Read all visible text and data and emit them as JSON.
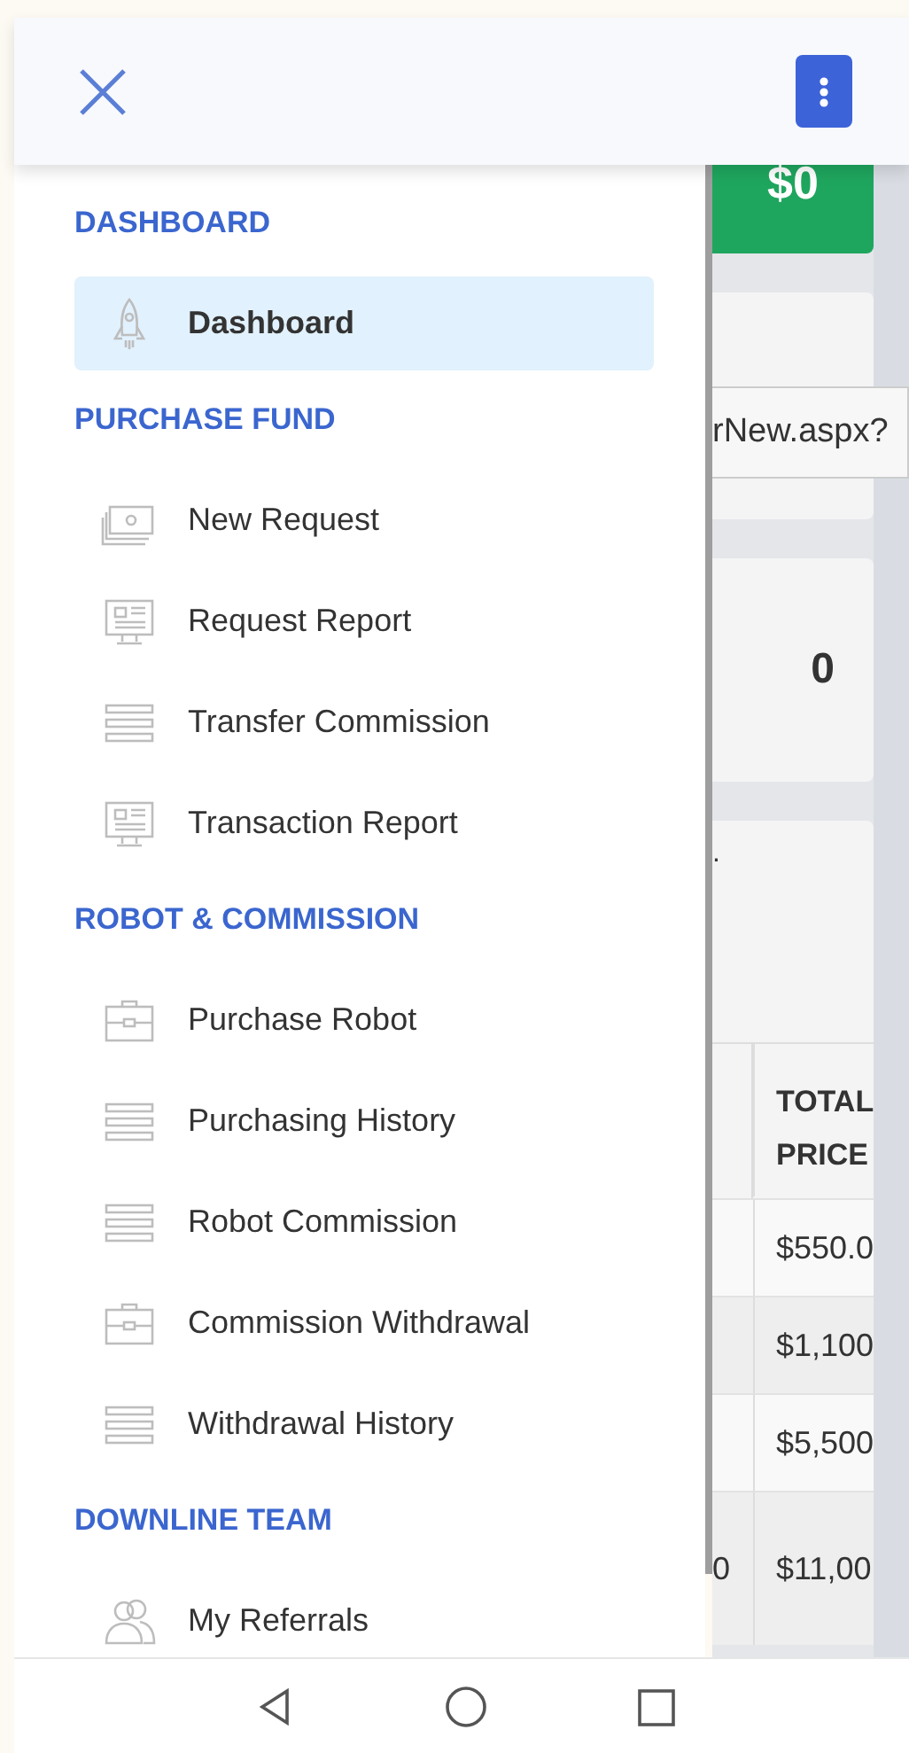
{
  "sections": [
    {
      "title": "DASHBOARD",
      "items": [
        {
          "label": "Dashboard",
          "kind": "rocket",
          "selected": true
        }
      ]
    },
    {
      "title": "PURCHASE FUND",
      "items": [
        {
          "label": "New Request",
          "kind": "money",
          "selected": false
        },
        {
          "label": "Request Report",
          "kind": "monitor",
          "selected": false
        },
        {
          "label": "Transfer Commission",
          "kind": "list",
          "selected": false
        },
        {
          "label": "Transaction Report",
          "kind": "monitor",
          "selected": false
        }
      ]
    },
    {
      "title": "ROBOT & COMMISSION",
      "items": [
        {
          "label": "Purchase Robot",
          "kind": "briefcase",
          "selected": false
        },
        {
          "label": "Purchasing History",
          "kind": "list",
          "selected": false
        },
        {
          "label": "Robot Commission",
          "kind": "list",
          "selected": false
        },
        {
          "label": "Commission Withdrawal",
          "kind": "briefcase",
          "selected": false
        },
        {
          "label": "Withdrawal History",
          "kind": "list",
          "selected": false
        }
      ]
    },
    {
      "title": "DOWNLINE TEAM",
      "items": [
        {
          "label": "My Referrals",
          "kind": "team",
          "selected": false
        }
      ]
    }
  ],
  "background": {
    "balance": "$0",
    "link_field": "rNew.aspx?",
    "count": "0",
    "mark": ".",
    "table": {
      "header": "TOTAL PRICE",
      "rows": [
        {
          "column_1": "",
          "price": "$550.0"
        },
        {
          "column_1": "",
          "price": "$1,100"
        },
        {
          "column_1": "",
          "price": "$5,500"
        },
        {
          "column_1": "0",
          "price": "$11,00"
        }
      ]
    }
  }
}
